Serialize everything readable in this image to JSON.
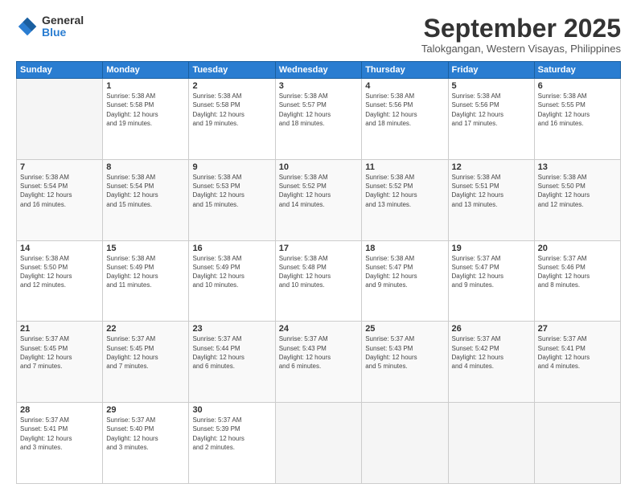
{
  "logo": {
    "general": "General",
    "blue": "Blue"
  },
  "header": {
    "month": "September 2025",
    "location": "Talokgangan, Western Visayas, Philippines"
  },
  "weekdays": [
    "Sunday",
    "Monday",
    "Tuesday",
    "Wednesday",
    "Thursday",
    "Friday",
    "Saturday"
  ],
  "weeks": [
    [
      {
        "day": "",
        "info": ""
      },
      {
        "day": "1",
        "info": "Sunrise: 5:38 AM\nSunset: 5:58 PM\nDaylight: 12 hours\nand 19 minutes."
      },
      {
        "day": "2",
        "info": "Sunrise: 5:38 AM\nSunset: 5:58 PM\nDaylight: 12 hours\nand 19 minutes."
      },
      {
        "day": "3",
        "info": "Sunrise: 5:38 AM\nSunset: 5:57 PM\nDaylight: 12 hours\nand 18 minutes."
      },
      {
        "day": "4",
        "info": "Sunrise: 5:38 AM\nSunset: 5:56 PM\nDaylight: 12 hours\nand 18 minutes."
      },
      {
        "day": "5",
        "info": "Sunrise: 5:38 AM\nSunset: 5:56 PM\nDaylight: 12 hours\nand 17 minutes."
      },
      {
        "day": "6",
        "info": "Sunrise: 5:38 AM\nSunset: 5:55 PM\nDaylight: 12 hours\nand 16 minutes."
      }
    ],
    [
      {
        "day": "7",
        "info": "Sunrise: 5:38 AM\nSunset: 5:54 PM\nDaylight: 12 hours\nand 16 minutes."
      },
      {
        "day": "8",
        "info": "Sunrise: 5:38 AM\nSunset: 5:54 PM\nDaylight: 12 hours\nand 15 minutes."
      },
      {
        "day": "9",
        "info": "Sunrise: 5:38 AM\nSunset: 5:53 PM\nDaylight: 12 hours\nand 15 minutes."
      },
      {
        "day": "10",
        "info": "Sunrise: 5:38 AM\nSunset: 5:52 PM\nDaylight: 12 hours\nand 14 minutes."
      },
      {
        "day": "11",
        "info": "Sunrise: 5:38 AM\nSunset: 5:52 PM\nDaylight: 12 hours\nand 13 minutes."
      },
      {
        "day": "12",
        "info": "Sunrise: 5:38 AM\nSunset: 5:51 PM\nDaylight: 12 hours\nand 13 minutes."
      },
      {
        "day": "13",
        "info": "Sunrise: 5:38 AM\nSunset: 5:50 PM\nDaylight: 12 hours\nand 12 minutes."
      }
    ],
    [
      {
        "day": "14",
        "info": "Sunrise: 5:38 AM\nSunset: 5:50 PM\nDaylight: 12 hours\nand 12 minutes."
      },
      {
        "day": "15",
        "info": "Sunrise: 5:38 AM\nSunset: 5:49 PM\nDaylight: 12 hours\nand 11 minutes."
      },
      {
        "day": "16",
        "info": "Sunrise: 5:38 AM\nSunset: 5:49 PM\nDaylight: 12 hours\nand 10 minutes."
      },
      {
        "day": "17",
        "info": "Sunrise: 5:38 AM\nSunset: 5:48 PM\nDaylight: 12 hours\nand 10 minutes."
      },
      {
        "day": "18",
        "info": "Sunrise: 5:38 AM\nSunset: 5:47 PM\nDaylight: 12 hours\nand 9 minutes."
      },
      {
        "day": "19",
        "info": "Sunrise: 5:37 AM\nSunset: 5:47 PM\nDaylight: 12 hours\nand 9 minutes."
      },
      {
        "day": "20",
        "info": "Sunrise: 5:37 AM\nSunset: 5:46 PM\nDaylight: 12 hours\nand 8 minutes."
      }
    ],
    [
      {
        "day": "21",
        "info": "Sunrise: 5:37 AM\nSunset: 5:45 PM\nDaylight: 12 hours\nand 7 minutes."
      },
      {
        "day": "22",
        "info": "Sunrise: 5:37 AM\nSunset: 5:45 PM\nDaylight: 12 hours\nand 7 minutes."
      },
      {
        "day": "23",
        "info": "Sunrise: 5:37 AM\nSunset: 5:44 PM\nDaylight: 12 hours\nand 6 minutes."
      },
      {
        "day": "24",
        "info": "Sunrise: 5:37 AM\nSunset: 5:43 PM\nDaylight: 12 hours\nand 6 minutes."
      },
      {
        "day": "25",
        "info": "Sunrise: 5:37 AM\nSunset: 5:43 PM\nDaylight: 12 hours\nand 5 minutes."
      },
      {
        "day": "26",
        "info": "Sunrise: 5:37 AM\nSunset: 5:42 PM\nDaylight: 12 hours\nand 4 minutes."
      },
      {
        "day": "27",
        "info": "Sunrise: 5:37 AM\nSunset: 5:41 PM\nDaylight: 12 hours\nand 4 minutes."
      }
    ],
    [
      {
        "day": "28",
        "info": "Sunrise: 5:37 AM\nSunset: 5:41 PM\nDaylight: 12 hours\nand 3 minutes."
      },
      {
        "day": "29",
        "info": "Sunrise: 5:37 AM\nSunset: 5:40 PM\nDaylight: 12 hours\nand 3 minutes."
      },
      {
        "day": "30",
        "info": "Sunrise: 5:37 AM\nSunset: 5:39 PM\nDaylight: 12 hours\nand 2 minutes."
      },
      {
        "day": "",
        "info": ""
      },
      {
        "day": "",
        "info": ""
      },
      {
        "day": "",
        "info": ""
      },
      {
        "day": "",
        "info": ""
      }
    ]
  ]
}
